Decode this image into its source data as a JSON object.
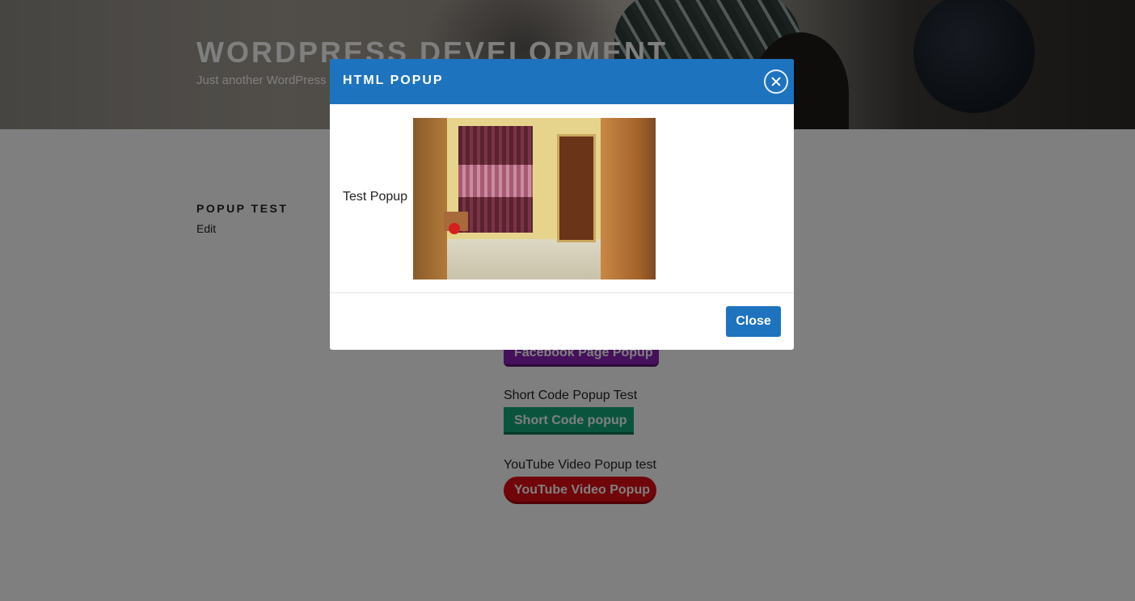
{
  "site": {
    "title": "WordPress Development",
    "description": "Just another WordPress site"
  },
  "page": {
    "entry_title": "Popup Test",
    "edit_label": "Edit",
    "buttons": {
      "facebook": "Facebook Page Popup",
      "shortcode_heading": "Short Code Popup Test",
      "shortcode": "Short Code popup",
      "youtube_heading": "YouTube Video Popup test",
      "youtube": "YouTube Video Popup"
    }
  },
  "modal": {
    "title": "HTML Popup",
    "body_text": "Test Popup",
    "close_label": "Close",
    "header_color": "#1e73be"
  },
  "colors": {
    "facebook_button": "#8a20b8",
    "shortcode_button": "#15a97c",
    "youtube_button": "#e00a14"
  },
  "icons": {
    "modal_close": "close-circle-icon"
  }
}
